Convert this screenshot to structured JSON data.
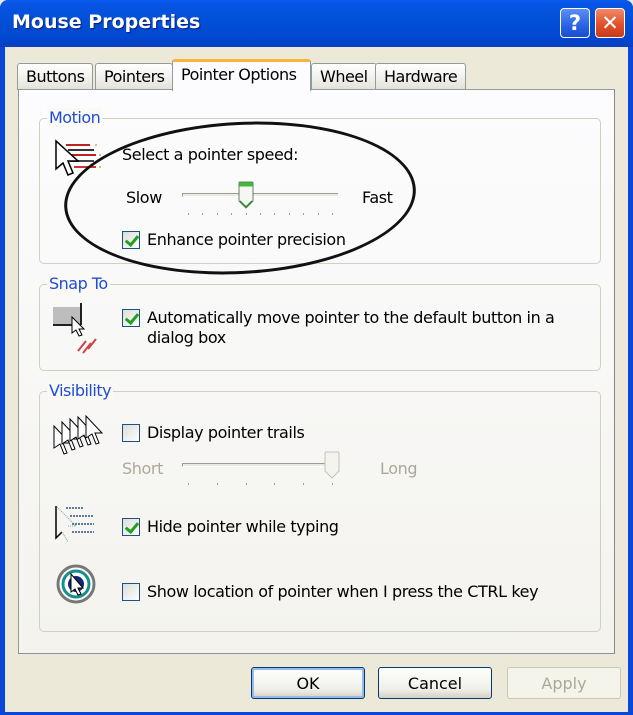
{
  "window": {
    "title": "Mouse Properties",
    "help_label": "?",
    "close_label": "✕"
  },
  "tabs": [
    {
      "label": "Buttons",
      "active": false
    },
    {
      "label": "Pointers",
      "active": false
    },
    {
      "label": "Pointer Options",
      "active": true
    },
    {
      "label": "Wheel",
      "active": false
    },
    {
      "label": "Hardware",
      "active": false
    }
  ],
  "motion": {
    "group_label": "Motion",
    "icon": "pointer-speed-icon",
    "speed_prompt": "Select a pointer speed:",
    "slow_label": "Slow",
    "fast_label": "Fast",
    "speed_value": 4,
    "speed_min": 0,
    "speed_max": 10,
    "enhance_precision_label": "Enhance pointer precision",
    "enhance_precision_checked": true
  },
  "snap_to": {
    "group_label": "Snap To",
    "icon": "snap-to-icon",
    "auto_move_label_line1": "Automatically move pointer to the default button in a",
    "auto_move_label_line2": "dialog box",
    "auto_move_checked": true
  },
  "visibility": {
    "group_label": "Visibility",
    "trails_icon": "pointer-trails-icon",
    "trails_label": "Display pointer trails",
    "trails_checked": false,
    "short_label": "Short",
    "long_label": "Long",
    "trail_length_value": 5,
    "trail_length_min": 0,
    "trail_length_max": 5,
    "hide_icon": "hide-pointer-icon",
    "hide_label": "Hide pointer while typing",
    "hide_checked": true,
    "location_icon": "pointer-location-icon",
    "location_label": "Show location of pointer when I press the CTRL key",
    "location_checked": false
  },
  "buttons": {
    "ok": "OK",
    "cancel": "Cancel",
    "apply": "Apply"
  },
  "annotation": {
    "highlight": "hand-drawn oval around pointer speed controls"
  }
}
